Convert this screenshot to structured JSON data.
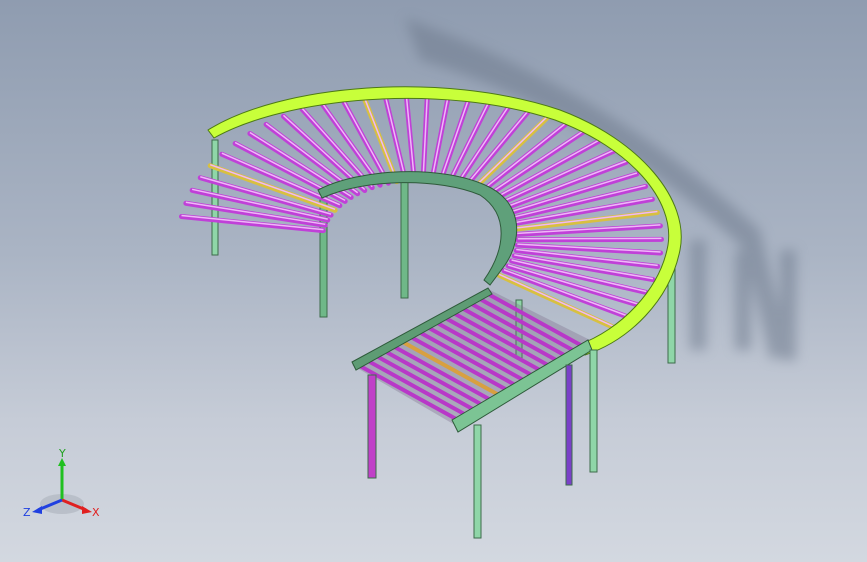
{
  "viewport": {
    "background_top": "#8f9cb0",
    "background_bottom": "#d3d8e0"
  },
  "model": {
    "frame_color": "#c8ff3a",
    "roller_color": "#c040d8",
    "roller_highlight": "#e9a8f5",
    "leg_color": "#8fd6a8",
    "leg_accent": "#b03ab8",
    "rail_color": "#6a9a78",
    "shadow_color": "#6f7b8e"
  },
  "triad": {
    "y_label": "Y",
    "x_label": "X",
    "z_label": "Z",
    "x_color": "#e02020",
    "y_color": "#20c020",
    "z_color": "#2040e0"
  }
}
